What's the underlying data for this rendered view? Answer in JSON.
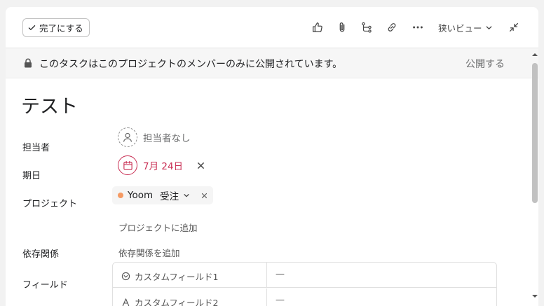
{
  "toolbar": {
    "complete_label": "完了にする",
    "view_label": "狭いビュー"
  },
  "banner": {
    "text": "このタスクはこのプロジェクトのメンバーのみに公開されています。",
    "action_label": "公開する"
  },
  "task": {
    "title": "テスト"
  },
  "fields": {
    "assignee_label": "担当者",
    "assignee_value": "担当者なし",
    "due_label": "期日",
    "due_value": "7月 24日",
    "project_label": "プロジェクト",
    "project_name": "Yoom",
    "project_section": "受注",
    "add_project": "プロジェクトに追加",
    "dependency_label": "依存関係",
    "add_dependency": "依存関係を追加",
    "custom_label": "フィールド"
  },
  "custom_fields": [
    {
      "name": "カスタムフィールド1",
      "value": "—",
      "icon": "dropdown-circle-icon"
    },
    {
      "name": "カスタムフィールド2",
      "value": "—",
      "icon": "text-a-icon"
    }
  ],
  "colors": {
    "due_accent": "#c92f54",
    "project_dot": "#f59a63"
  }
}
